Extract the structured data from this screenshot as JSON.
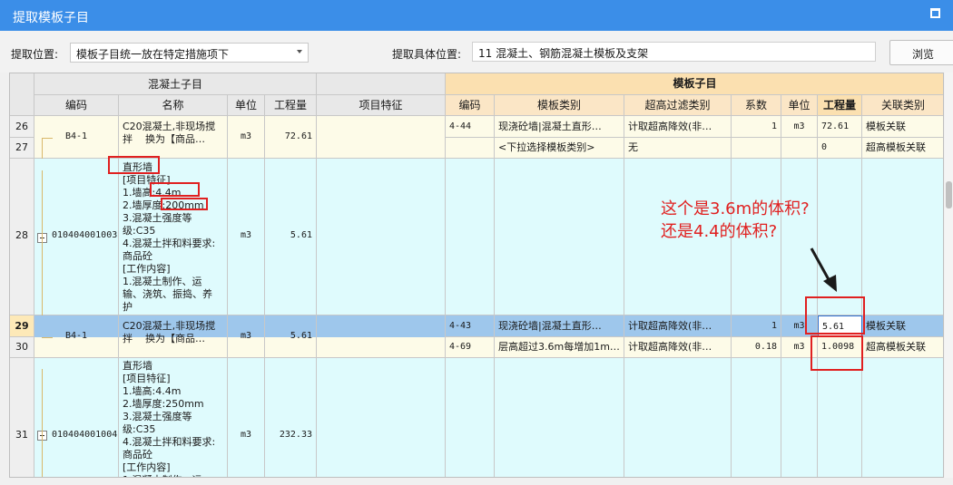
{
  "window": {
    "title": "提取模板子目"
  },
  "toolbar": {
    "position_label": "提取位置:",
    "position_value": "模板子目统一放在特定措施项下",
    "specific_label": "提取具体位置:",
    "specific_value": "11 混凝土、钢筋混凝土模板及支架",
    "browse_label": "浏览"
  },
  "headers": {
    "group_left": "混凝土子目",
    "group_right": "模板子目",
    "code": "编码",
    "name": "名称",
    "unit": "单位",
    "qty": "工程量",
    "feature": "项目特征",
    "r_code": "编码",
    "r_type": "模板类别",
    "r_filter": "超高过滤类别",
    "r_coef": "系数",
    "r_unit": "单位",
    "r_qty": "工程量",
    "r_rel": "关联类别"
  },
  "rows": {
    "r26": {
      "num": "26",
      "code": "B4-1",
      "name": "C20混凝土,非现场搅\n拌    换为【商品…",
      "unit": "m3",
      "qty": "72.61",
      "r_code": "4-44",
      "r_type": "现浇砼墙|混凝土直形…",
      "r_filter": "计取超高降效(非…",
      "r_coef": "1",
      "r_unit": "m3",
      "r_qty": "72.61",
      "r_rel": "模板关联"
    },
    "r27": {
      "num": "27",
      "r_type": "<下拉选择模板类别>",
      "r_filter": "无",
      "r_qty": "0",
      "r_rel": "超高模板关联"
    },
    "r28": {
      "num": "28",
      "code": "010404001003",
      "name": "直形墙\n[项目特征]\n1.墙高:4.4m\n2.墙厚度:200mm\n3.混凝土强度等\n级:C35\n4.混凝土拌和料要求:\n商品砼\n[工作内容]\n1.混凝土制作、运\n输、浇筑、振捣、养\n护",
      "unit": "m3",
      "qty": "5.61"
    },
    "r29": {
      "num": "29",
      "code": "B4-1",
      "name": "C20混凝土,非现场搅\n拌    换为【商品…",
      "unit": "m3",
      "qty": "5.61",
      "r_code": "4-43",
      "r_type": "现浇砼墙|混凝土直形…",
      "r_filter": "计取超高降效(非…",
      "r_coef": "1",
      "r_unit": "m3",
      "r_qty": "5.61",
      "r_rel": "模板关联"
    },
    "r30": {
      "num": "30",
      "r_code": "4-69",
      "r_type": "层高超过3.6m每增加1m…",
      "r_filter": "计取超高降效(非…",
      "r_coef": "0.18",
      "r_unit": "m3",
      "r_qty": "1.0098",
      "r_rel": "超高模板关联"
    },
    "r31": {
      "num": "31",
      "code": "010404001004",
      "name": "直形墙\n[项目特征]\n1.墙高:4.4m\n2.墙厚度:250mm\n3.混凝土强度等\n级:C35\n4.混凝土拌和料要求:\n商品砼\n[工作内容]\n1.混凝土制作、运",
      "unit": "m3",
      "qty": "232.33"
    }
  },
  "annotation": {
    "text": "这个是3.6m的体积?还是4.4的体积?"
  },
  "colors": {
    "titlebar": "#3b8ee8",
    "row_cyan": "#dffbfd",
    "row_cream": "#fdfbe8",
    "row_selected": "#9ec7ec",
    "highlight": "#e02020"
  }
}
